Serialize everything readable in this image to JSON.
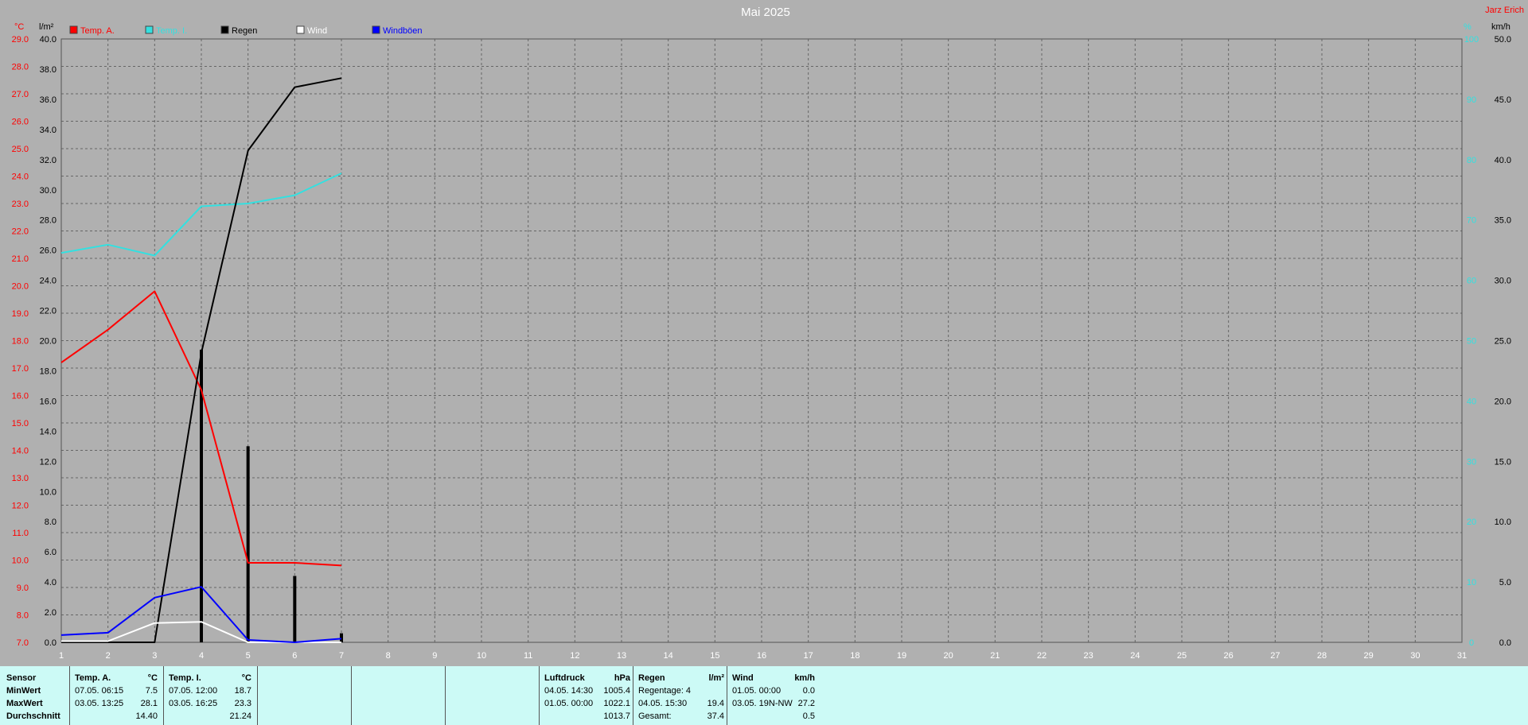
{
  "chart_data": {
    "type": "line",
    "title": "Mai 2025",
    "corner_label": "Jarz Erich",
    "x": [
      1,
      2,
      3,
      4,
      5,
      6,
      7,
      8,
      9,
      10,
      11,
      12,
      13,
      14,
      15,
      16,
      17,
      18,
      19,
      20,
      21,
      22,
      23,
      24,
      25,
      26,
      27,
      28,
      29,
      30,
      31
    ],
    "xlim": [
      1,
      31
    ],
    "left_axis_temp": {
      "unit": "°C",
      "ylim": [
        7.0,
        29.0
      ],
      "ticks": [
        "7.0",
        "8.0",
        "9.0",
        "10.0",
        "11.0",
        "12.0",
        "13.0",
        "14.0",
        "15.0",
        "16.0",
        "17.0",
        "18.0",
        "19.0",
        "20.0",
        "21.0",
        "22.0",
        "23.0",
        "24.0",
        "25.0",
        "26.0",
        "27.0",
        "28.0",
        "29.0"
      ]
    },
    "left_axis_rain": {
      "unit": "l/m²",
      "ylim": [
        0.0,
        40.0
      ],
      "ticks": [
        "0.0",
        "2.0",
        "4.0",
        "6.0",
        "8.0",
        "10.0",
        "12.0",
        "14.0",
        "16.0",
        "18.0",
        "20.0",
        "22.0",
        "24.0",
        "26.0",
        "28.0",
        "30.0",
        "32.0",
        "34.0",
        "36.0",
        "38.0",
        "40.0"
      ]
    },
    "right_axis_wind": {
      "unit": "km/h",
      "ylim": [
        0.0,
        50.0
      ],
      "ticks": [
        "0.0",
        "5.0",
        "10.0",
        "15.0",
        "20.0",
        "25.0",
        "30.0",
        "35.0",
        "40.0",
        "45.0",
        "50.0"
      ]
    },
    "right_axis_hum": {
      "unit": "%",
      "ticks": [
        "0",
        "10",
        "20",
        "30",
        "40",
        "50",
        "60",
        "70",
        "80",
        "90",
        "100"
      ]
    },
    "grid": true,
    "legend_position": "top-left",
    "series": [
      {
        "name": "Temp. A.",
        "axis": "temp",
        "color": "#ff0000",
        "x": [
          1,
          2,
          3,
          4,
          5,
          6,
          7
        ],
        "values": [
          17.2,
          18.4,
          19.8,
          16.2,
          9.9,
          9.9,
          9.8
        ]
      },
      {
        "name": "Temp. I.",
        "axis": "temp",
        "color": "#33e0e0",
        "x": [
          1,
          2,
          3,
          4,
          5,
          6,
          7
        ],
        "values": [
          21.2,
          21.5,
          21.1,
          22.9,
          23.0,
          23.3,
          24.1
        ]
      },
      {
        "name": "Regen",
        "axis": "rain",
        "color": "#000000",
        "x": [
          1,
          2,
          3,
          4,
          5,
          6,
          7
        ],
        "values": [
          0.0,
          0.0,
          0.0,
          19.2,
          32.6,
          36.8,
          37.4
        ]
      },
      {
        "name": "Wind",
        "axis": "wind",
        "color": "#ffffff",
        "x": [
          1,
          2,
          3,
          4,
          5,
          6,
          7
        ],
        "values": [
          0.1,
          0.1,
          1.6,
          1.7,
          0.0,
          0.0,
          0.0
        ]
      },
      {
        "name": "Windböen",
        "axis": "wind",
        "color": "#0000ff",
        "x": [
          1,
          2,
          3,
          4,
          5,
          6,
          7
        ],
        "values": [
          0.6,
          0.8,
          3.7,
          4.6,
          0.2,
          0.0,
          0.3
        ]
      }
    ],
    "rain_bars": {
      "color": "#000000",
      "x": [
        4,
        5,
        6,
        7
      ],
      "values": [
        19.4,
        13.0,
        4.4,
        0.6
      ]
    }
  },
  "stats": {
    "sensor": {
      "header": "Sensor",
      "rows": [
        "MinWert",
        "MaxWert",
        "Durchschnitt"
      ]
    },
    "temp_a": {
      "title": "Temp. A.",
      "unit": "°C",
      "min_time": "07.05.  06:15",
      "min_val": "7.5",
      "max_time": "03.05.  13:25",
      "max_val": "28.1",
      "avg_val": "14.40"
    },
    "temp_i": {
      "title": "Temp. I.",
      "unit": "°C",
      "min_time": "07.05.  12:00",
      "min_val": "18.7",
      "max_time": "03.05.  16:25",
      "max_val": "23.3",
      "avg_val": "21.24"
    },
    "luftdruck": {
      "title": "Luftdruck",
      "unit": "hPa",
      "min_time": "04.05.  14:30",
      "min_val": "1005.4",
      "max_time": "01.05.  00:00",
      "max_val": "1022.1",
      "avg_val": "1013.7"
    },
    "regen": {
      "title": "Regen",
      "unit": "l/m²",
      "row1": "Regentage: 4",
      "row2_time": "04.05.  15:30",
      "row2_val": "19.4",
      "row3_label": "Gesamt:",
      "row3_val": "37.4"
    },
    "wind": {
      "title": "Wind",
      "unit": "km/h",
      "min_time": "01.05.  00:00",
      "min_val": "0.0",
      "max_time": "03.05.  19N-NW",
      "max_val": "27.2",
      "avg_val": "0.5"
    }
  }
}
